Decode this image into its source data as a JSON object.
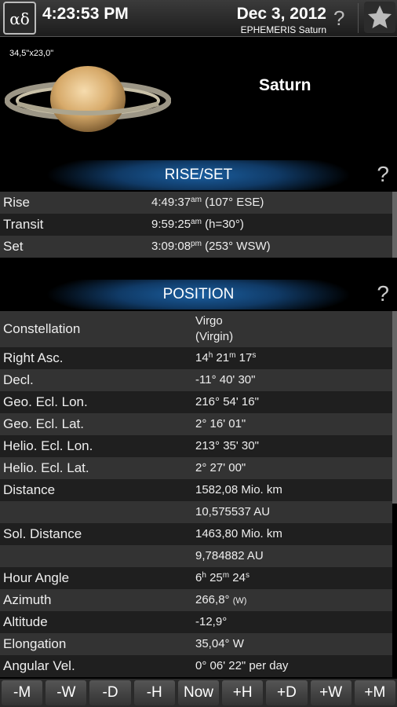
{
  "header": {
    "logo_text": "αδ",
    "time": "4:23:53 PM",
    "date": "Dec 3, 2012",
    "subtitle": "EPHEMERIS Saturn",
    "help": "?"
  },
  "object": {
    "size_label": "34,5\"x23,0\"",
    "name": "Saturn"
  },
  "riseset": {
    "title": "RISE/SET",
    "help": "?",
    "rows": [
      {
        "label": "Rise",
        "main": "4:49:37",
        "sup": "am",
        "rest": " (107° ESE)"
      },
      {
        "label": "Transit",
        "main": "9:59:25",
        "sup": "am",
        "rest": " (h=30°)"
      },
      {
        "label": "Set",
        "main": "3:09:08",
        "sup": "pm",
        "rest": " (253° WSW)"
      }
    ]
  },
  "position": {
    "title": "POSITION",
    "help": "?",
    "constellation": {
      "label": "Constellation",
      "line1": "Virgo",
      "line2": "(Virgin)"
    },
    "ra": {
      "label": "Right Asc.",
      "h": "14",
      "m": "21",
      "s": "17"
    },
    "rows": [
      {
        "label": "Decl.",
        "value": "-11° 40' 30\""
      },
      {
        "label": "Geo. Ecl. Lon.",
        "value": "216° 54' 16\""
      },
      {
        "label": "Geo. Ecl. Lat.",
        "value": "2° 16' 01\""
      },
      {
        "label": "Helio. Ecl. Lon.",
        "value": "213° 35' 30\""
      },
      {
        "label": "Helio. Ecl. Lat.",
        "value": "2° 27' 00\""
      },
      {
        "label": "Distance",
        "value": "1582,08 Mio. km"
      },
      {
        "label": "",
        "value": "10,575537 AU"
      },
      {
        "label": "Sol. Distance",
        "value": "1463,80 Mio. km"
      },
      {
        "label": "",
        "value": "9,784882 AU"
      }
    ],
    "hour_angle": {
      "label": "Hour Angle",
      "h": "6",
      "m": "25",
      "s": "24"
    },
    "azimuth": {
      "label": "Azimuth",
      "value": "266,8°",
      "note": "(W)"
    },
    "rows2": [
      {
        "label": "Altitude",
        "value": "-12,9°"
      },
      {
        "label": "Elongation",
        "value": "35,04° W"
      },
      {
        "label": "Angular Vel.",
        "value": "0° 06' 22\" per day"
      }
    ]
  },
  "nav_buttons": [
    "-M",
    "-W",
    "-D",
    "-H",
    "Now",
    "+H",
    "+D",
    "+W",
    "+M"
  ]
}
